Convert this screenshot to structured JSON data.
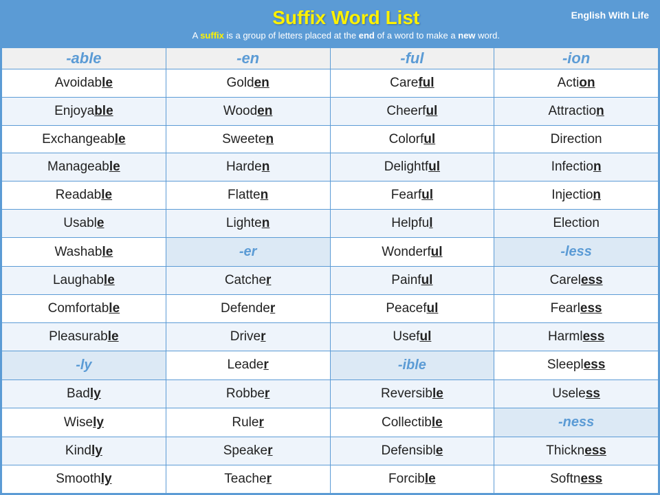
{
  "header": {
    "title": "Suffix Word List",
    "subtitle_before": "A ",
    "suffix_word": "suffix",
    "subtitle_mid": " is a group of letters placed at the ",
    "end_word": "end",
    "subtitle_mid2": " of a word to make a ",
    "new_word": "new",
    "subtitle_after": " word.",
    "brand": "English With Life"
  },
  "columns": [
    "-able",
    "-en",
    "-ful",
    "-ion"
  ],
  "rows": [
    {
      "able": {
        "text": "Avoidable",
        "suffix_start": 7
      },
      "en": {
        "text": "Golden",
        "suffix_start": 4
      },
      "ful": {
        "text": "Careful",
        "suffix_start": 4
      },
      "ion": {
        "text": "Action",
        "suffix_start": 4
      }
    },
    {
      "able": {
        "text": "Enjoyable",
        "suffix_start": 6
      },
      "en": {
        "text": "Wooden",
        "suffix_start": 4
      },
      "ful": {
        "text": "Cheerful",
        "suffix_start": 6
      },
      "ion": {
        "text": "Attraction",
        "suffix_start": 9
      }
    },
    {
      "able": {
        "text": "Exchangeable",
        "suffix_start": 10
      },
      "en": {
        "text": "Sweeten",
        "suffix_start": 6
      },
      "ful": {
        "text": "Colorful",
        "suffix_start": 6
      },
      "ion": {
        "text": "Direction",
        "suffix_start": 9
      }
    },
    {
      "able": {
        "text": "Manageable",
        "suffix_start": 8
      },
      "en": {
        "text": "Harden",
        "suffix_start": 5
      },
      "ful": {
        "text": "Delightful",
        "suffix_start": 8
      },
      "ion": {
        "text": "Infection",
        "suffix_start": 8
      }
    },
    {
      "able": {
        "text": "Readable",
        "suffix_start": 6
      },
      "en": {
        "text": "Flatten",
        "suffix_start": 6
      },
      "ful": {
        "text": "Fearful",
        "suffix_start": 5
      },
      "ion": {
        "text": "Injection",
        "suffix_start": 8
      }
    },
    {
      "able": {
        "text": "Usable",
        "suffix_start": 5
      },
      "en": {
        "text": "Lighten",
        "suffix_start": 6
      },
      "ful": {
        "text": "Helpful",
        "suffix_start": 6
      },
      "ion": {
        "text": "Election",
        "suffix_start": 8
      }
    },
    {
      "able": {
        "text": "Washable",
        "suffix_start": 6
      },
      "en": {
        "text": "-er",
        "suffix_start": 0,
        "is_suffix": true
      },
      "ful": {
        "text": "Wonderful",
        "suffix_start": 7
      },
      "ion": {
        "text": "-less",
        "suffix_start": 0,
        "is_suffix": true
      }
    },
    {
      "able": {
        "text": "Laughable",
        "suffix_start": 7
      },
      "en": {
        "text": "Catcher",
        "suffix_start": 6
      },
      "ful": {
        "text": "Painful",
        "suffix_start": 5
      },
      "ion": {
        "text": "Careless",
        "suffix_start": 5
      }
    },
    {
      "able": {
        "text": "Comfortable",
        "suffix_start": 9
      },
      "en": {
        "text": "Defender",
        "suffix_start": 7
      },
      "ful": {
        "text": "Peaceful",
        "suffix_start": 6
      },
      "ion": {
        "text": "Fearless",
        "suffix_start": 5
      }
    },
    {
      "able": {
        "text": "Pleasurable",
        "suffix_start": 9
      },
      "en": {
        "text": "Driver",
        "suffix_start": 5
      },
      "ful": {
        "text": "Useful",
        "suffix_start": 4
      },
      "ion": {
        "text": "Harmless",
        "suffix_start": 5
      }
    },
    {
      "able": {
        "text": "-ly",
        "suffix_start": 0,
        "is_suffix": true
      },
      "en": {
        "text": "Leader",
        "suffix_start": 5
      },
      "ful": {
        "text": "-ible",
        "suffix_start": 0,
        "is_suffix": true
      },
      "ion": {
        "text": "Sleepless",
        "suffix_start": 6
      }
    },
    {
      "able": {
        "text": "Badly",
        "suffix_start": 3
      },
      "en": {
        "text": "Robber",
        "suffix_start": 5
      },
      "ful": {
        "text": "Reversible",
        "suffix_start": 8
      },
      "ion": {
        "text": "Useless",
        "suffix_start": 5
      }
    },
    {
      "able": {
        "text": "Wisely",
        "suffix_start": 4
      },
      "en": {
        "text": "Ruler",
        "suffix_start": 4
      },
      "ful": {
        "text": "Collectible",
        "suffix_start": 9
      },
      "ion": {
        "text": "-ness",
        "suffix_start": 0,
        "is_suffix": true
      }
    },
    {
      "able": {
        "text": "Kindly",
        "suffix_start": 4
      },
      "en": {
        "text": "Speaker",
        "suffix_start": 6
      },
      "ful": {
        "text": "Defensible",
        "suffix_start": 9
      },
      "ion": {
        "text": "Thickness",
        "suffix_start": 6
      }
    },
    {
      "able": {
        "text": "Smoothly",
        "suffix_start": 6
      },
      "en": {
        "text": "Teacher",
        "suffix_start": 6
      },
      "ful": {
        "text": "Forcible",
        "suffix_start": 6
      },
      "ion": {
        "text": "Softness",
        "suffix_start": 5
      }
    }
  ]
}
